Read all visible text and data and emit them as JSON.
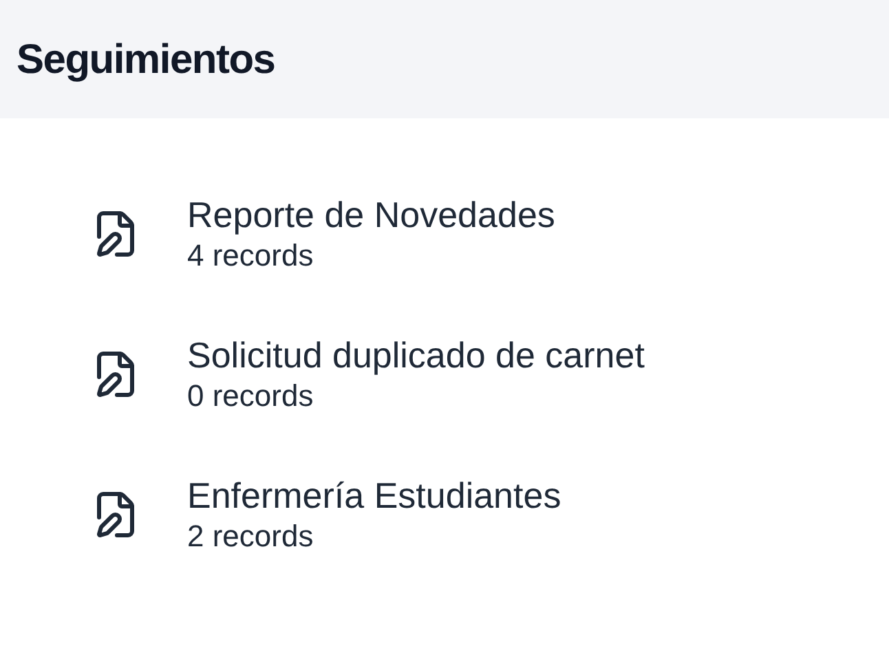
{
  "header": {
    "title": "Seguimientos"
  },
  "items": [
    {
      "title": "Reporte de Novedades",
      "count": "4 records"
    },
    {
      "title": "Solicitud duplicado de carnet",
      "count": "0 records"
    },
    {
      "title": "Enfermería Estudiantes",
      "count": "2 records"
    }
  ]
}
